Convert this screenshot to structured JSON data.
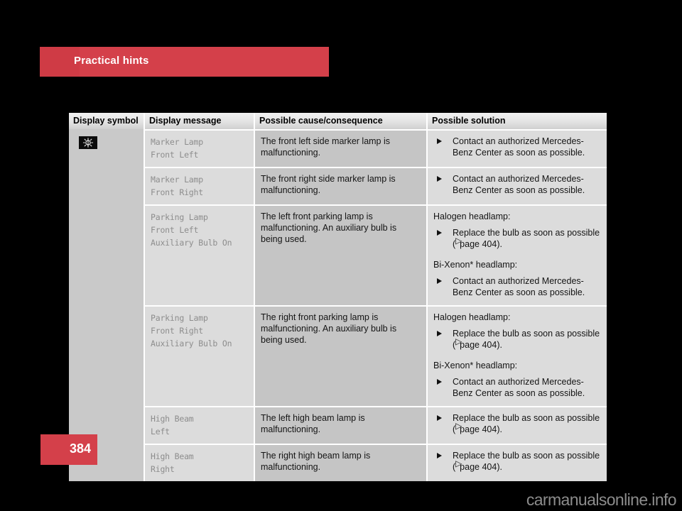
{
  "header": {
    "section_title": "Practical hints"
  },
  "table": {
    "columns": [
      {
        "key": "symbol",
        "label": "Display symbol"
      },
      {
        "key": "message",
        "label": "Display message"
      },
      {
        "key": "cause",
        "label": "Possible cause/consequence"
      },
      {
        "key": "solution",
        "label": "Possible solution"
      }
    ],
    "symbol_icon": "marker-lamp-indicator-icon",
    "rows": [
      {
        "message_lines": [
          "Marker Lamp",
          "Front Left"
        ],
        "cause": "The front left side marker lamp is malfunctioning.",
        "solution_blocks": [
          {
            "type": "bullet",
            "text": "Contact an authorized Mercedes-Benz Center as soon as possible."
          }
        ]
      },
      {
        "message_lines": [
          "Marker Lamp",
          "Front Right"
        ],
        "cause": "The front right side marker lamp is malfunctioning.",
        "solution_blocks": [
          {
            "type": "bullet",
            "text": "Contact an authorized Mercedes-Benz Center as soon as possible."
          }
        ]
      },
      {
        "message_lines": [
          "Parking Lamp",
          "Front Left",
          "Auxiliary Bulb On"
        ],
        "cause": "The left front parking lamp is malfunctioning. An auxiliary bulb is being used.",
        "solution_blocks": [
          {
            "type": "label",
            "text": "Halogen headlamp:"
          },
          {
            "type": "bullet",
            "text": "Replace the bulb as soon as possible (",
            "ref": "page 404",
            "tail": ")."
          },
          {
            "type": "label",
            "text": "Bi-Xenon* headlamp:"
          },
          {
            "type": "bullet",
            "text": "Contact an authorized Mercedes-Benz Center as soon as possible."
          }
        ]
      },
      {
        "message_lines": [
          "Parking Lamp",
          "Front Right",
          "Auxiliary Bulb On"
        ],
        "cause": "The right front parking lamp is malfunctioning. An auxiliary bulb is being used.",
        "solution_blocks": [
          {
            "type": "label",
            "text": "Halogen headlamp:"
          },
          {
            "type": "bullet",
            "text": "Replace the bulb as soon as possible (",
            "ref": "page 404",
            "tail": ")."
          },
          {
            "type": "label",
            "text": "Bi-Xenon* headlamp:"
          },
          {
            "type": "bullet",
            "text": "Contact an authorized Mercedes-Benz Center as soon as possible."
          }
        ]
      },
      {
        "message_lines": [
          "High Beam",
          "Left"
        ],
        "cause": "The left high beam lamp is malfunctioning.",
        "solution_blocks": [
          {
            "type": "bullet",
            "text": "Replace the bulb as soon as possible (",
            "ref": "page 404",
            "tail": ")."
          }
        ]
      },
      {
        "message_lines": [
          "High Beam",
          "Right"
        ],
        "cause": "The right high beam lamp is malfunctioning.",
        "solution_blocks": [
          {
            "type": "bullet",
            "text": "Replace the bulb as soon as possible (",
            "ref": "page 404",
            "tail": ")."
          }
        ]
      }
    ]
  },
  "footer": {
    "page_number": "384",
    "watermark": "carmanualsonline.info"
  },
  "colors": {
    "accent_red": "#d4404a",
    "accent_red_dark": "#cf3b45",
    "page_background": "#000000",
    "col_symbol_bg": "#c9c9c9",
    "col_message_bg": "#dcdcdc",
    "col_cause_bg": "#c5c5c5",
    "col_solution_bg": "#dcdcdc",
    "message_text": "#8d8d8d"
  }
}
